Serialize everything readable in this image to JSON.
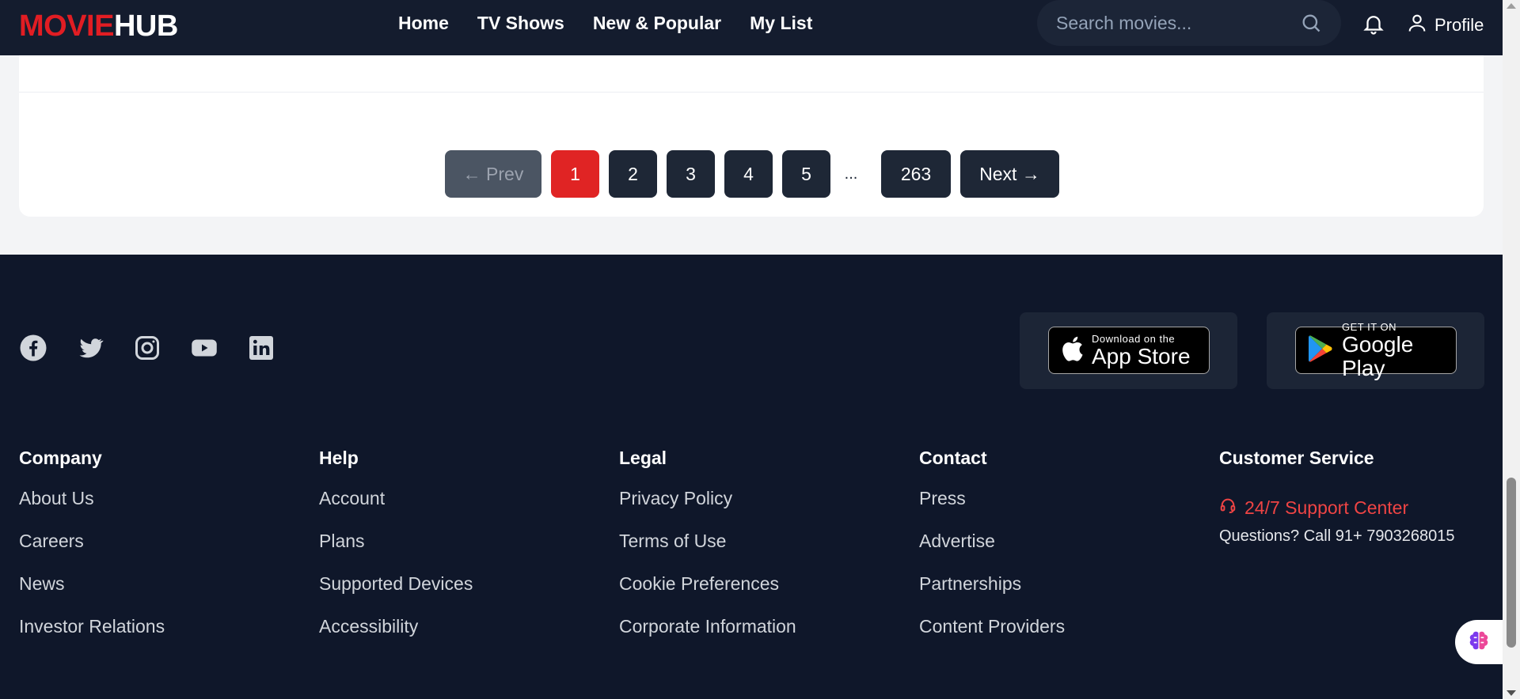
{
  "header": {
    "logo_part1": "MOVIE",
    "logo_part2": "HUB",
    "nav": [
      "Home",
      "TV Shows",
      "New & Popular",
      "My List"
    ],
    "search_placeholder": "Search movies...",
    "profile_label": "Profile"
  },
  "pagination": {
    "prev_label": "← Prev",
    "pages": [
      "1",
      "2",
      "3",
      "4",
      "5"
    ],
    "active_page": "1",
    "ellipsis": "...",
    "last_page": "263",
    "next_label": "Next →"
  },
  "footer": {
    "social_icons": [
      "facebook-icon",
      "twitter-icon",
      "instagram-icon",
      "youtube-icon",
      "linkedin-icon"
    ],
    "app_store": {
      "small": "Download on the",
      "big": "App Store"
    },
    "google_play": {
      "small": "GET IT ON",
      "big": "Google Play"
    },
    "columns": [
      {
        "title": "Company",
        "links": [
          "About Us",
          "Careers",
          "News",
          "Investor Relations"
        ]
      },
      {
        "title": "Help",
        "links": [
          "Account",
          "Plans",
          "Supported Devices",
          "Accessibility"
        ]
      },
      {
        "title": "Legal",
        "links": [
          "Privacy Policy",
          "Terms of Use",
          "Cookie Preferences",
          "Corporate Information"
        ]
      },
      {
        "title": "Contact",
        "links": [
          "Press",
          "Advertise",
          "Partnerships",
          "Content Providers"
        ]
      }
    ],
    "customer_service": {
      "title": "Customer Service",
      "support_label": "24/7 Support Center",
      "phone_text": "Questions? Call 91+ 7903268015"
    }
  },
  "colors": {
    "brand_red": "#e11d23",
    "footer_bg": "#0f172a",
    "button_dark": "#1e2736"
  }
}
